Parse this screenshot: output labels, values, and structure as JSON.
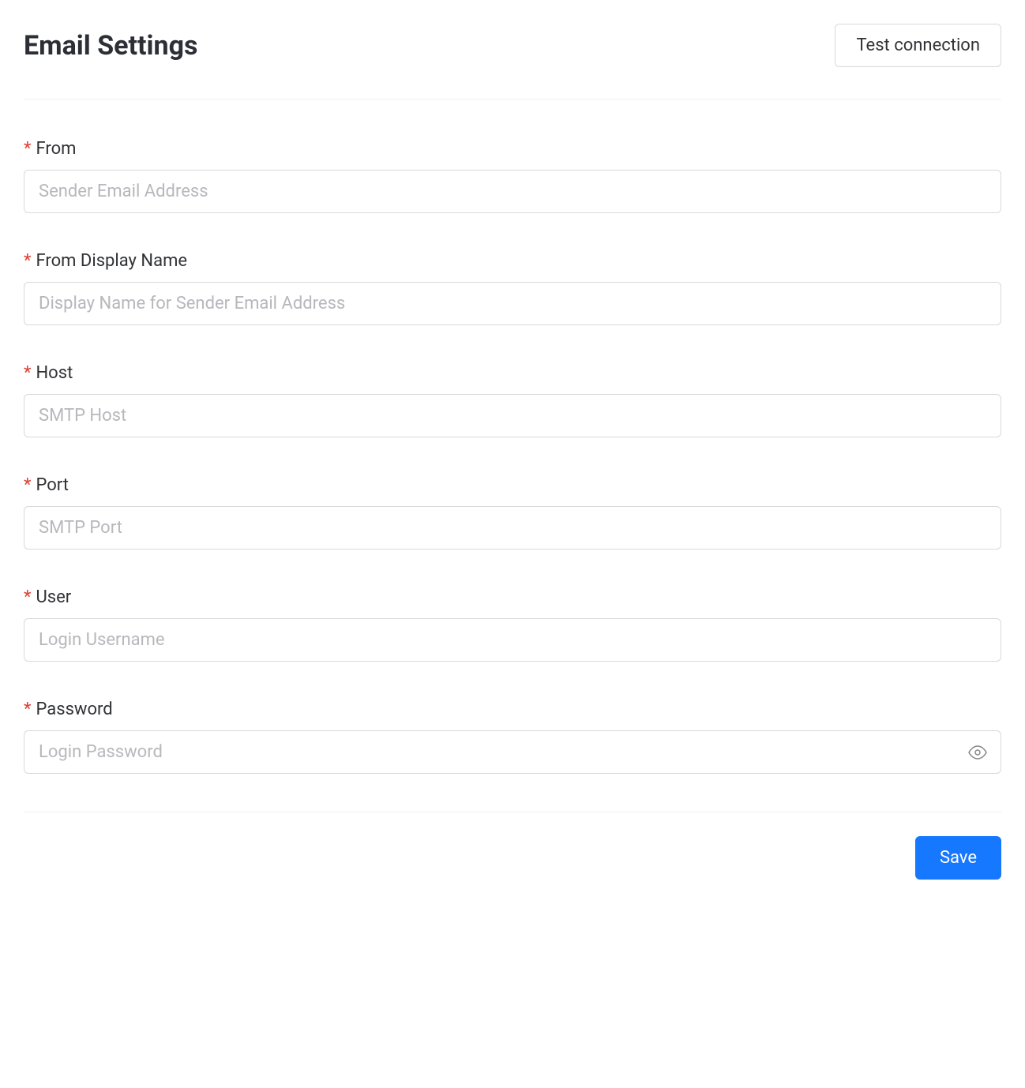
{
  "header": {
    "title": "Email Settings",
    "test_button_label": "Test connection"
  },
  "form": {
    "fields": {
      "from": {
        "label": "From",
        "placeholder": "Sender Email Address",
        "value": "",
        "required": true
      },
      "from_display_name": {
        "label": "From Display Name",
        "placeholder": "Display Name for Sender Email Address",
        "value": "",
        "required": true
      },
      "host": {
        "label": "Host",
        "placeholder": "SMTP Host",
        "value": "",
        "required": true
      },
      "port": {
        "label": "Port",
        "placeholder": "SMTP Port",
        "value": "",
        "required": true
      },
      "user": {
        "label": "User",
        "placeholder": "Login Username",
        "value": "",
        "required": true
      },
      "password": {
        "label": "Password",
        "placeholder": "Login Password",
        "value": "",
        "required": true
      }
    }
  },
  "footer": {
    "save_button_label": "Save"
  }
}
